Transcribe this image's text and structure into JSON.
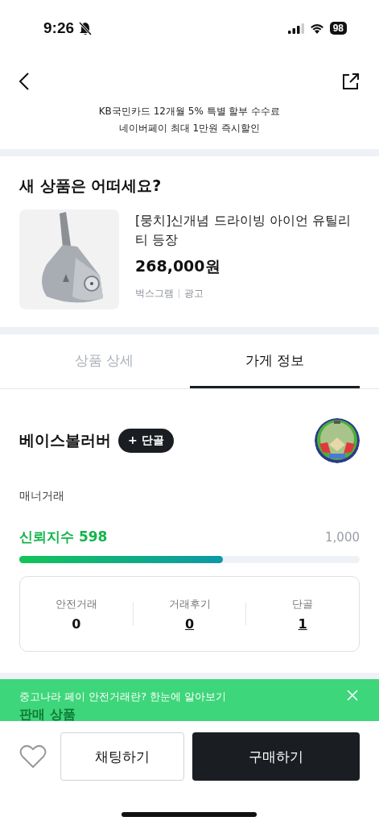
{
  "status_bar": {
    "time": "9:26",
    "battery": "98"
  },
  "promo": {
    "lines": [
      "KB국민카드 12개월 5% 특별 할부 수수료",
      "네이버페이 최대 1만원 즉시할인"
    ]
  },
  "recommend": {
    "title": "새 상품은 어떠세요?",
    "product": {
      "kind": "picture",
      "name": "[뭉치]신개념 드라이빙 아이언 유틸리티 등장",
      "price": "268,000원",
      "seller": "벅스그램",
      "ad": "광고"
    }
  },
  "tabs": [
    {
      "label": "상품 상세",
      "selected": false
    },
    {
      "label": "가게 정보",
      "selected": true
    }
  ],
  "shop": {
    "name": "베이스볼러버",
    "follow_button": "+ 단골",
    "tag": "매너거래",
    "trust_label": "신뢰지수 598",
    "trust_max": "1,000",
    "trust": {
      "level": 0.598
    },
    "stats": [
      {
        "label": "안전거래",
        "value": "0",
        "link": false
      },
      {
        "label": "거래후기",
        "value": "0",
        "link": true
      },
      {
        "label": "단골",
        "value": "1",
        "link": true
      }
    ]
  },
  "section_title": "판매 상품",
  "banner": {
    "text": "중고나라 페이 안전거래란? 한눈에 알아보기"
  },
  "bottom_bar": {
    "liked": false,
    "chat_button": "채팅하기",
    "buy_button": "구매하기"
  }
}
